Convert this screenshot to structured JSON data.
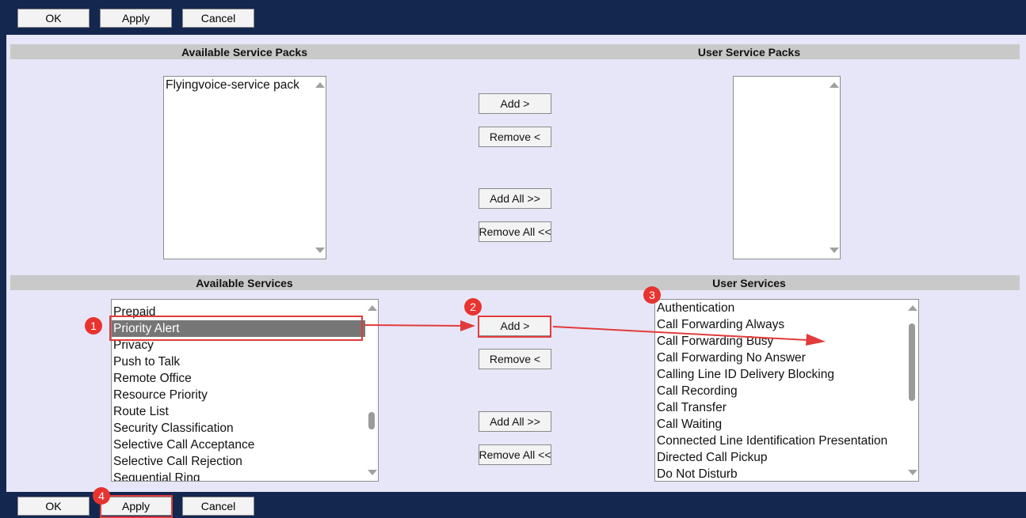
{
  "toolbar": {
    "ok_label": "OK",
    "apply_label": "Apply",
    "cancel_label": "Cancel"
  },
  "service_packs": {
    "available_header": "Available Service Packs",
    "user_header": "User Service Packs",
    "available_items": [
      "Flyingvoice-service pack"
    ],
    "user_items": []
  },
  "services": {
    "available_header": "Available Services",
    "user_header": "User Services",
    "available_items": [
      "Prepaid",
      "Priority Alert",
      "Privacy",
      "Push to Talk",
      "Remote Office",
      "Resource Priority",
      "Route List",
      "Security Classification",
      "Selective Call Acceptance",
      "Selective Call Rejection",
      "Sequential Ring"
    ],
    "selected_item": "Priority Alert",
    "user_items": [
      "Authentication",
      "Call Forwarding Always",
      "Call Forwarding Busy",
      "Call Forwarding No Answer",
      "Calling Line ID Delivery Blocking",
      "Call Recording",
      "Call Transfer",
      "Call Waiting",
      "Connected Line Identification Presentation",
      "Directed Call Pickup",
      "Do Not Disturb"
    ]
  },
  "move_buttons": {
    "add": "Add >",
    "remove": "Remove <",
    "add_all": "Add All >>",
    "remove_all": "Remove All <<"
  },
  "annotations": {
    "step1": "1",
    "step2": "2",
    "step3": "3",
    "step4": "4",
    "highlight_color": "#e23b3b"
  }
}
